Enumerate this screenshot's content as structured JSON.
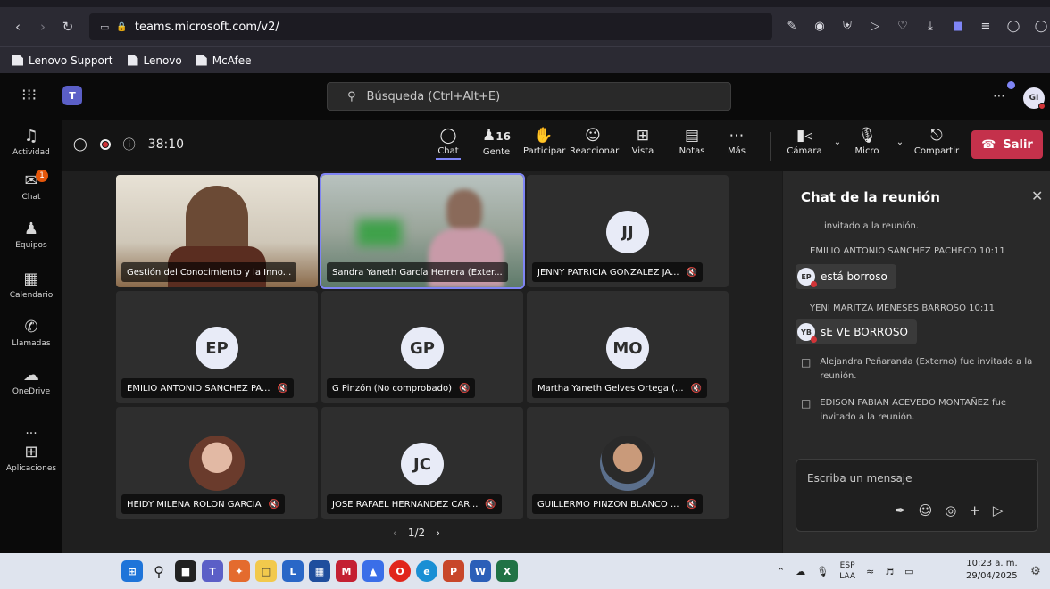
{
  "browser": {
    "url_prefix": "teams.",
    "url_host": "microsoft.com",
    "url_path": "/v2/",
    "bookmarks": [
      "Lenovo Support",
      "Lenovo",
      "McAfee"
    ]
  },
  "teams": {
    "search_placeholder": "Búsqueda (Ctrl+Alt+E)",
    "avatar_initials": "GI",
    "rail": [
      {
        "label": "Actividad",
        "icon": "bell-icon"
      },
      {
        "label": "Chat",
        "icon": "chat-icon",
        "badge": "1"
      },
      {
        "label": "Equipos",
        "icon": "teams-icon"
      },
      {
        "label": "Calendario",
        "icon": "calendar-icon"
      },
      {
        "label": "Llamadas",
        "icon": "phone-icon"
      },
      {
        "label": "OneDrive",
        "icon": "cloud-icon"
      },
      {
        "label": "...",
        "icon": "more-icon"
      },
      {
        "label": "Aplicaciones",
        "icon": "plus-square-icon"
      }
    ]
  },
  "meeting": {
    "timer": "38:10",
    "toolbar": {
      "chat": "Chat",
      "people": "Gente",
      "people_count": "16",
      "raise": "Participar",
      "react": "Reaccionar",
      "view": "Vista",
      "notes": "Notas",
      "more": "Más",
      "camera": "Cámara",
      "mic": "Micro",
      "share": "Compartir",
      "leave": "Salir"
    },
    "tiles": [
      {
        "name": "Gestión del Conocimiento y la Inno...",
        "type": "video"
      },
      {
        "name": "Sandra Yaneth García Herrera (Exter...",
        "type": "video"
      },
      {
        "name": "JENNY PATRICIA GONZALEZ JA...",
        "initials": "JJ"
      },
      {
        "name": "EMILIO ANTONIO SANCHEZ PA...",
        "initials": "EP"
      },
      {
        "name": "G Pinzón (No comprobado)",
        "initials": "GP"
      },
      {
        "name": "Martha Yaneth Gelves Ortega (...",
        "initials": "MO"
      },
      {
        "name": "HEIDY MILENA ROLON GARCIA",
        "type": "photo"
      },
      {
        "name": "JOSE RAFAEL HERNANDEZ CAR...",
        "initials": "JC"
      },
      {
        "name": "GUILLERMO PINZON BLANCO ...",
        "type": "photo"
      }
    ],
    "pager": "1/2"
  },
  "chat": {
    "title": "Chat de la reunión",
    "top_sys": "invitado a la reunión.",
    "msg1_sender": "EMILIO ANTONIO SANCHEZ PACHECO  10:11",
    "msg1_initials": "EP",
    "msg1_text": "está borroso",
    "msg2_sender": "YENI MARITZA MENESES BARROSO  10:11",
    "msg2_initials": "YB",
    "msg2_text": "sE VE BORROSO",
    "sys1": "Alejandra Peñaranda (Externo) fue invitado a la reunión.",
    "sys2": "EDISON FABIAN ACEVEDO MONTAÑEZ fue invitado a la reunión.",
    "composer_placeholder": "Escriba un mensaje"
  },
  "taskbar": {
    "lang1": "ESP",
    "lang2": "LAA",
    "time": "10:23 a. m.",
    "date": "29/04/2025"
  }
}
